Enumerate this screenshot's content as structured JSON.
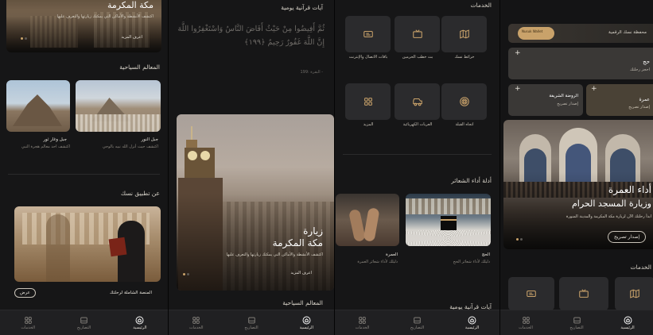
{
  "colors": {
    "accent": "#c9a26a",
    "bg": "#161617",
    "tile": "#2b2b2d"
  },
  "nav": {
    "services": "الخدمات",
    "permits": "التصاريح",
    "home": "الرئيسية"
  },
  "screen1": {
    "hero_title": "مكة المكرمة",
    "hero_subtitle": "اكتشف الأنشطة والأماكن التي يمكنك زيارتها والتعرف عليها",
    "hero_link": "اعرف المزيد",
    "landmarks_title": "المعالم السياحية",
    "landmarks": [
      {
        "name": "جبل النور",
        "desc": "اكتشف حيث أنزل الله نبيه بالوحي"
      },
      {
        "name": "جبل وغار ثور",
        "desc": "اكتشف أحد معالم هجرة النبي"
      }
    ],
    "about_title": "عن تطبيق نسك",
    "about_caption": "المنصة الشاملة لرحلتك",
    "about_button": "عرض"
  },
  "screen2": {
    "verses_title": "آيات قرآنية يومية",
    "verse_text": "ثُمَّ أَفِيضُوا مِنْ حَيْثُ أَفَاضَ النَّاسُ وَاسْتَغْفِرُوا اللَّهَ إِنَّ اللَّهَ غَفُورٌ رَحِيمٌ ﴿١٩٩﴾",
    "verse_ref": "- البقرة :199",
    "card_title_1": "زيارة",
    "card_title_2": "مكة المكرمة",
    "card_subtitle": "اكتشف الأنشطة والأماكن التي يمكنك زيارتها والتعرف عليها",
    "card_link": "اعرف المزيد",
    "landmarks_title": "المعالم السياحية"
  },
  "screen3": {
    "services_title": "الخدمات",
    "services": [
      {
        "label": "خرائط نسك",
        "icon": "map-icon"
      },
      {
        "label": "بث خطب الحرمين",
        "icon": "tv-icon"
      },
      {
        "label": "باقات الاتصال والإنترنت",
        "icon": "sim-card-icon"
      },
      {
        "label": "اتجاه القبلة",
        "icon": "qibla-icon"
      },
      {
        "label": "العربات الكهربائية",
        "icon": "cart-icon"
      },
      {
        "label": "المزيد",
        "icon": "grid-icon"
      }
    ],
    "guides_title": "أدلة أداء الشعائر",
    "guides": [
      {
        "name": "الحج",
        "desc": "دليلك لأداء شعائر الحج"
      },
      {
        "name": "العمرة",
        "desc": "دليلك لأداء شعائر العمرة"
      }
    ],
    "verses_title": "آيات قرآنية يومية"
  },
  "screen4": {
    "wallet_title": "محفظة نسك الرقمية",
    "wallet_card": "Nusuk Wallet",
    "hajj_title": "حج",
    "hajj_sub": "احجز رحلتك",
    "umrah_title": "عمرة",
    "umrah_sub": "إصدار تصريح",
    "rawdah_title": "الروضة الشريفة",
    "rawdah_sub": "إصدار تصريح",
    "hero_title_1": "أداء العمرة",
    "hero_title_2": "وزيارة المسجد الحرام",
    "hero_subtitle": "ابدأ رحلتك الآن لزيارة مكة المكرمة والمدينة المنورة",
    "hero_button": "إصدار تصريح",
    "services_title": "الخدمات"
  }
}
